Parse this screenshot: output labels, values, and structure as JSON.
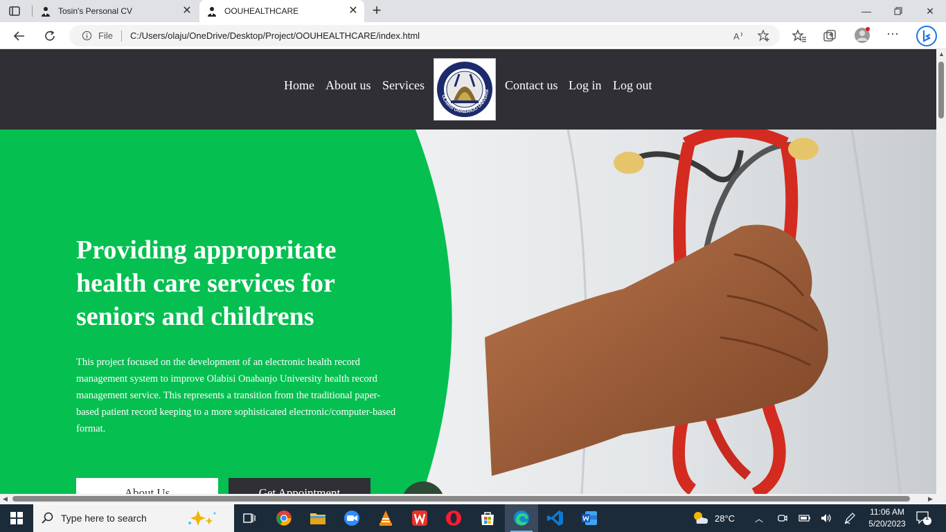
{
  "browser": {
    "tabs": [
      {
        "title": "Tosin's Personal CV",
        "active": false
      },
      {
        "title": "OOUHEALTHCARE",
        "active": true
      }
    ],
    "address": {
      "scheme_label": "File",
      "url": "C:/Users/olaju/OneDrive/Desktop/Project/OOUHEALTHCARE/index.html"
    }
  },
  "site": {
    "nav_left": [
      "Home",
      "About us",
      "Services"
    ],
    "nav_right": [
      "Contact us",
      "Log in",
      "Log out"
    ],
    "logo_text": "OLABISI ONABANJO UNIVERSITY"
  },
  "hero": {
    "title": "Providing appropritate health care services for seniors and childrens",
    "description": "This project focused on the development of an electronic health record management system to improve Olabisi Onabanjo University health record management service. This represents a transition from the traditional paper-based patient record keeping to a more sophisticated electronic/computer-based format.",
    "buttons": {
      "about": "About Us",
      "appointment": "Get Appointment"
    }
  },
  "taskbar": {
    "search_placeholder": "Type here to search",
    "weather": "28°C",
    "time": "11:06 AM",
    "date": "5/20/2023",
    "notifications": "1"
  },
  "colors": {
    "hero_green": "#06bf51",
    "header_dark": "#2f2f35",
    "taskbar": "#1c2b3a"
  }
}
